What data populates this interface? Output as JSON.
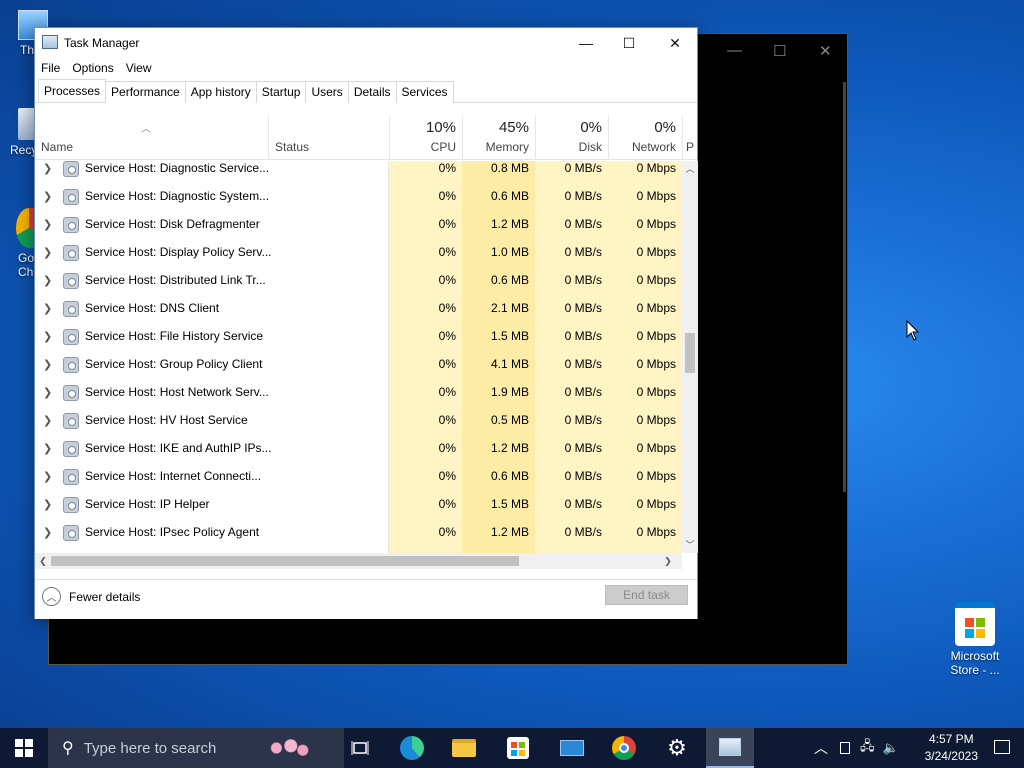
{
  "desktop": {
    "icons": [
      {
        "label": "Th"
      },
      {
        "label": "Recy"
      },
      {
        "label": "Go Ch"
      },
      {
        "label": "Microsoft Store - ..."
      }
    ]
  },
  "task_manager": {
    "title": "Task Manager",
    "window_buttons": {
      "minimize": "—",
      "maximize": "☐",
      "close": "✕"
    },
    "menu": [
      "File",
      "Options",
      "View"
    ],
    "tabs": [
      "Processes",
      "Performance",
      "App history",
      "Startup",
      "Users",
      "Details",
      "Services"
    ],
    "active_tab": "Processes",
    "columns": {
      "name": "Name",
      "status": "Status",
      "cpu": {
        "pct": "10%",
        "label": "CPU"
      },
      "memory": {
        "pct": "45%",
        "label": "Memory"
      },
      "disk": {
        "pct": "0%",
        "label": "Disk"
      },
      "network": {
        "pct": "0%",
        "label": "Network"
      },
      "power_partial": "P"
    },
    "rows": [
      {
        "name": "Service Host: Diagnostic Service...",
        "cpu": "0%",
        "memory": "0.8 MB",
        "disk": "0 MB/s",
        "network": "0 Mbps"
      },
      {
        "name": "Service Host: Diagnostic System...",
        "cpu": "0%",
        "memory": "0.6 MB",
        "disk": "0 MB/s",
        "network": "0 Mbps"
      },
      {
        "name": "Service Host: Disk Defragmenter",
        "cpu": "0%",
        "memory": "1.2 MB",
        "disk": "0 MB/s",
        "network": "0 Mbps"
      },
      {
        "name": "Service Host: Display Policy Serv...",
        "cpu": "0%",
        "memory": "1.0 MB",
        "disk": "0 MB/s",
        "network": "0 Mbps"
      },
      {
        "name": "Service Host: Distributed Link Tr...",
        "cpu": "0%",
        "memory": "0.6 MB",
        "disk": "0 MB/s",
        "network": "0 Mbps"
      },
      {
        "name": "Service Host: DNS Client",
        "cpu": "0%",
        "memory": "2.1 MB",
        "disk": "0 MB/s",
        "network": "0 Mbps"
      },
      {
        "name": "Service Host: File History Service",
        "cpu": "0%",
        "memory": "1.5 MB",
        "disk": "0 MB/s",
        "network": "0 Mbps"
      },
      {
        "name": "Service Host: Group Policy Client",
        "cpu": "0%",
        "memory": "4.1 MB",
        "disk": "0 MB/s",
        "network": "0 Mbps"
      },
      {
        "name": "Service Host: Host Network Serv...",
        "cpu": "0%",
        "memory": "1.9 MB",
        "disk": "0 MB/s",
        "network": "0 Mbps"
      },
      {
        "name": "Service Host: HV Host Service",
        "cpu": "0%",
        "memory": "0.5 MB",
        "disk": "0 MB/s",
        "network": "0 Mbps"
      },
      {
        "name": "Service Host: IKE and AuthIP IPs...",
        "cpu": "0%",
        "memory": "1.2 MB",
        "disk": "0 MB/s",
        "network": "0 Mbps"
      },
      {
        "name": "Service Host: Internet Connecti...",
        "cpu": "0%",
        "memory": "0.6 MB",
        "disk": "0 MB/s",
        "network": "0 Mbps"
      },
      {
        "name": "Service Host: IP Helper",
        "cpu": "0%",
        "memory": "1.5 MB",
        "disk": "0 MB/s",
        "network": "0 Mbps"
      },
      {
        "name": "Service Host: IPsec Policy Agent",
        "cpu": "0%",
        "memory": "1.2 MB",
        "disk": "0 MB/s",
        "network": "0 Mbps"
      }
    ],
    "footer": {
      "fewer_details": "Fewer details",
      "end_task": "End task"
    }
  },
  "taskbar": {
    "search_placeholder": "Type here to search",
    "apps": [
      "task-view",
      "edge",
      "file-explorer",
      "store",
      "mail",
      "chrome",
      "settings",
      "task-manager"
    ],
    "clock": {
      "time": "4:57 PM",
      "date": "3/24/2023"
    }
  },
  "colors": {
    "cpu_col": "#fff4c4",
    "memory_col": "#fceca6",
    "taskbar": "#0e1a33",
    "desktop": "#1a6fd6"
  }
}
